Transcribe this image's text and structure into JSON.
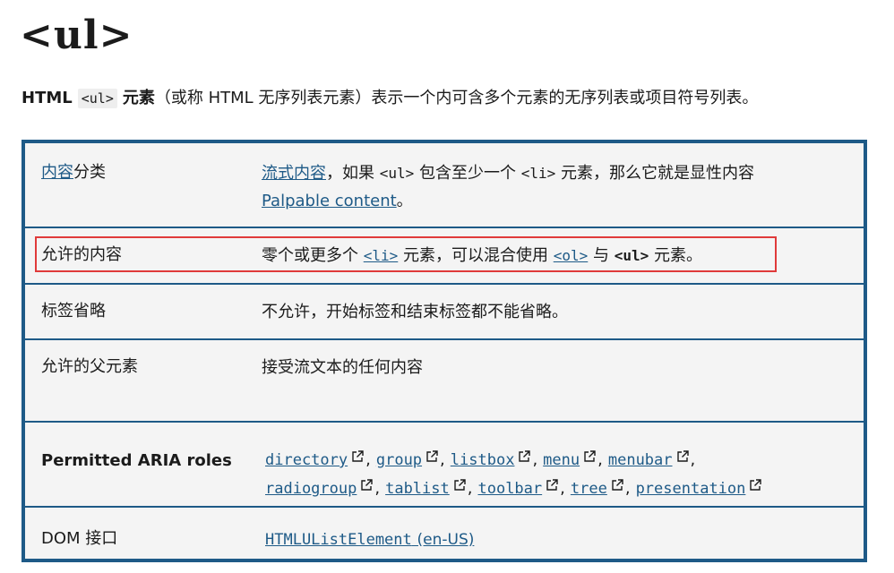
{
  "title": "<ul>",
  "intro": {
    "strong_pre": "HTML",
    "code": "<ul>",
    "strong_post": "元素",
    "text": "（或称 HTML 无序列表元素）表示一个内可含多个元素的无序列表或项目符号列表。"
  },
  "rows": {
    "content_categories": {
      "key_link": "内容",
      "key_text": "分类",
      "val_link": "流式内容",
      "val_text_1": "，如果",
      "val_code_1": "<ul>",
      "val_text_2": "包含至少一个",
      "val_code_2": "<li>",
      "val_text_3": "元素，那么它就是显性内容",
      "val_link_2": "Palpable content",
      "val_text_4": "。"
    },
    "permitted_content": {
      "key": "允许的内容",
      "val_text_1": "零个或更多个",
      "val_link_1": "<li>",
      "val_text_2": "元素，可以混合使用",
      "val_link_2": "<ol>",
      "val_text_3": "与",
      "val_code": "<ul>",
      "val_text_4": "元素。"
    },
    "tag_omission": {
      "key": "标签省略",
      "val": "不允许，开始标签和结束标签都不能省略。"
    },
    "permitted_parents": {
      "key": "允许的父元素",
      "val": "接受流文本的任何内容"
    },
    "aria_roles": {
      "key": "Permitted ARIA roles",
      "roles": [
        "directory",
        "group",
        "listbox",
        "menu",
        "menubar",
        "radiogroup",
        "tablist",
        "toolbar",
        "tree",
        "presentation"
      ]
    },
    "dom_interface": {
      "key": "DOM 接口",
      "val_link": "HTMLUListElement",
      "val_suffix": "(en-US)"
    }
  },
  "colors": {
    "border": "#1e5a87",
    "link": "#1e5a87",
    "highlight": "#e03a3a",
    "table_bg": "#f4f4f4"
  },
  "icons": {
    "external": "external-link-icon"
  }
}
